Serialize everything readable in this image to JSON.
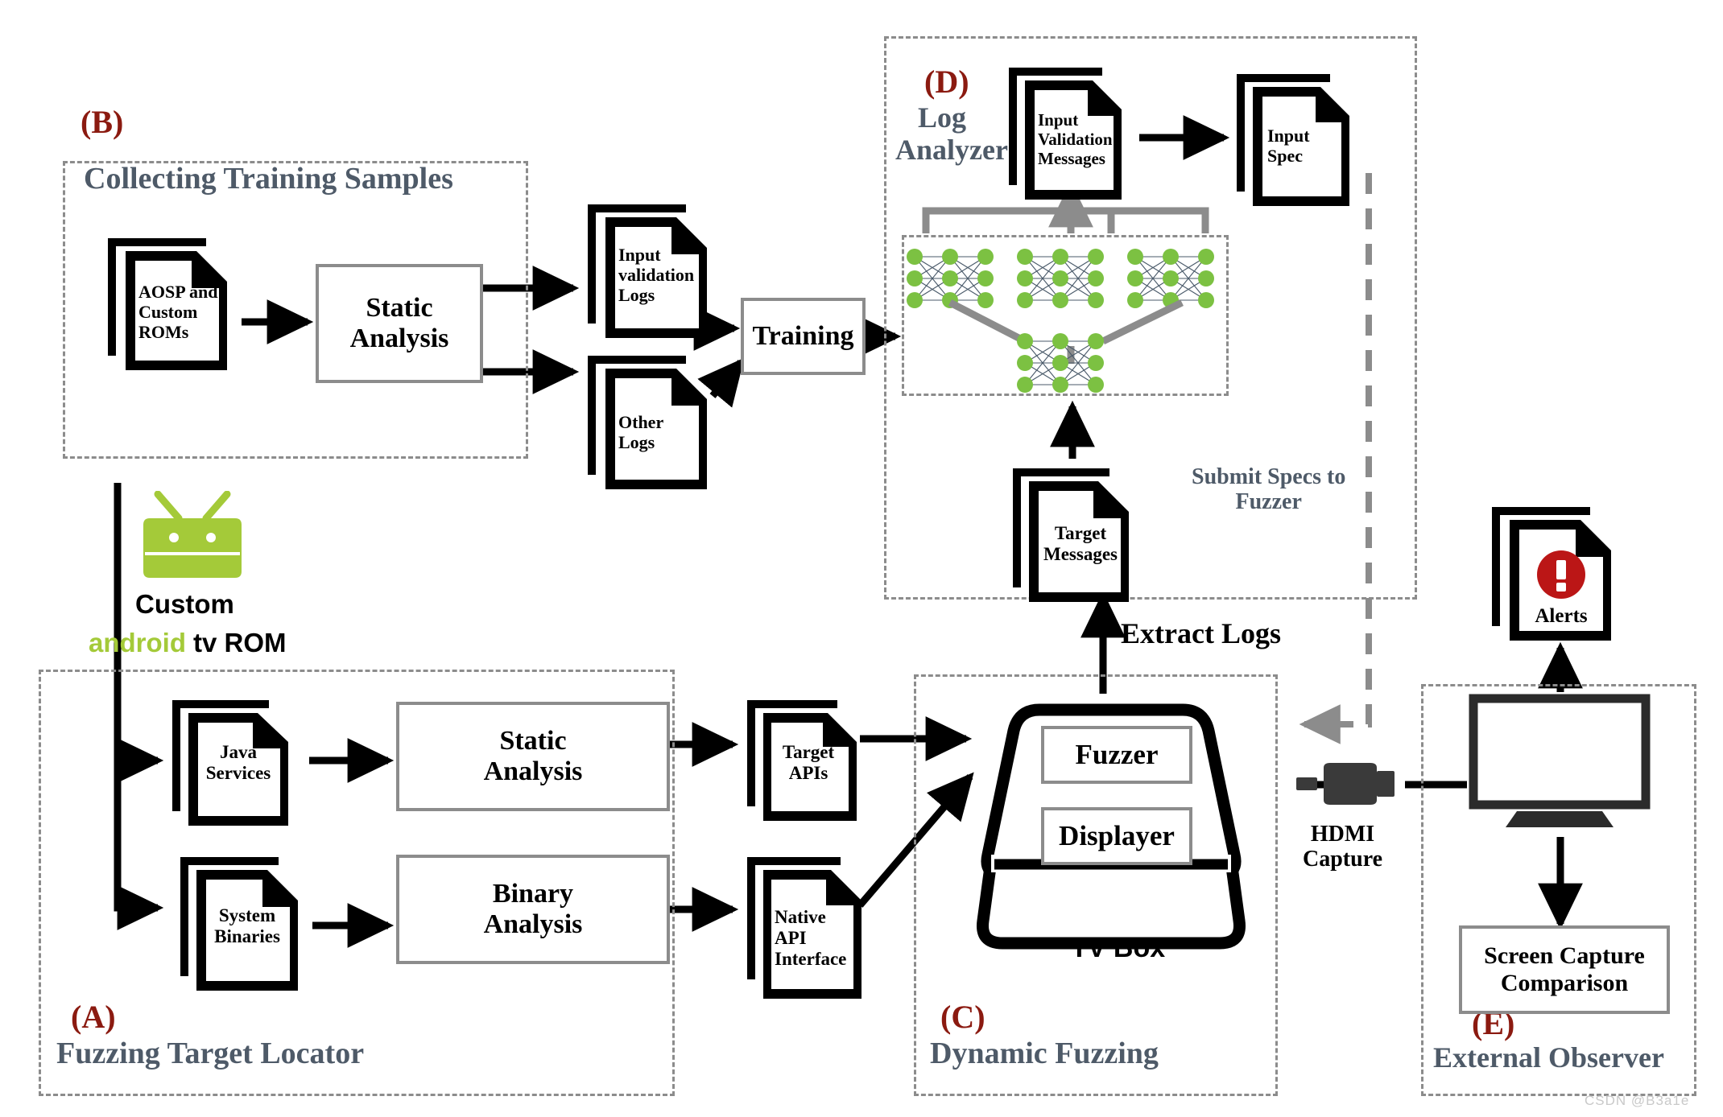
{
  "groups": {
    "a": {
      "letter": "(A)",
      "title": "Fuzzing Target Locator"
    },
    "b": {
      "letter": "(B)",
      "title": "Collecting Training Samples"
    },
    "c": {
      "letter": "(C)",
      "title": "Dynamic Fuzzing"
    },
    "d": {
      "letter": "(D)",
      "title_line1": "Log",
      "title_line2": "Analyzer"
    },
    "e": {
      "letter": "(E)",
      "title": "External Observer"
    }
  },
  "boxes": {
    "static_analysis_b": "Static\nAnalysis",
    "training": "Training",
    "static_analysis_a": "Static\nAnalysis",
    "binary_analysis": "Binary\nAnalysis",
    "fuzzer": "Fuzzer",
    "displayer": "Displayer",
    "screen_capture_comparison": "Screen Capture\nComparison"
  },
  "docs": {
    "aosp_custom_roms": "AOSP and\nCustom\nROMs",
    "input_validation_logs": "Input\nvalidation\nLogs",
    "other_logs": "Other\nLogs",
    "input_validation_messages": "Input\nValidation\nMessages",
    "input_spec": "Input\nSpec",
    "target_messages": "Target\nMessages",
    "java_services": "Java\nServices",
    "system_binaries": "System\nBinaries",
    "target_apis": "Target\nAPIs",
    "native_api_interface": "Native\nAPI\nInterface",
    "alerts": "Alerts"
  },
  "labels": {
    "submit_specs_to_fuzzer": "Submit Specs to\nFuzzer",
    "extract_logs": "Extract Logs",
    "hdmi_capture": "HDMI\nCapture",
    "tv_box": "TV Box"
  },
  "android_logo": {
    "custom": "Custom",
    "android": "android",
    "tv_rom": "tv ROM"
  },
  "watermark": "CSDN @B3a1e",
  "colors": {
    "group_border": "#8c8c8c",
    "group_letter": "#8b1a10",
    "group_title": "#4e5a68",
    "box_border": "#8c8c8c",
    "arrow_black": "#000000",
    "arrow_gray": "#8c8c8c",
    "neuron_green": "#7cc142",
    "android_green": "#a4ca39",
    "alert_red": "#bb1616",
    "hdmi_dark": "#3a3a3a",
    "watermark": "#c9c9c9"
  },
  "neural_net": {
    "columns": 3,
    "rows": 3,
    "sub_networks": 4
  }
}
